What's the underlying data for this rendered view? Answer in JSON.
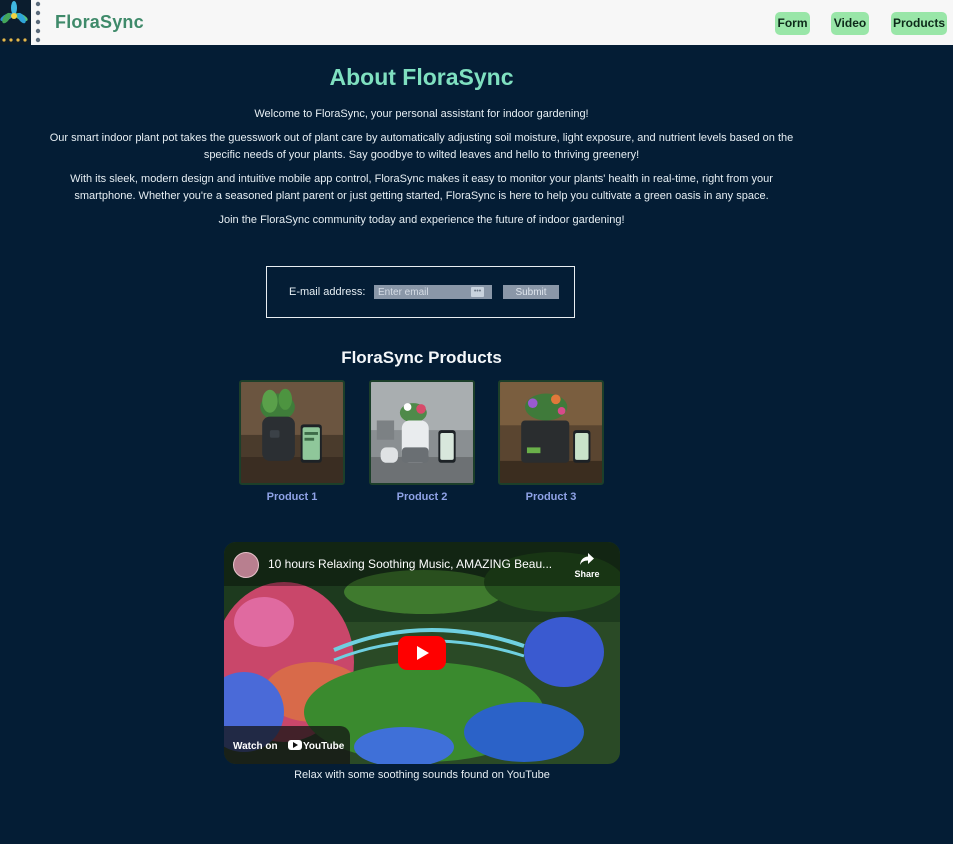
{
  "header": {
    "brand": "FloraSync",
    "nav": [
      {
        "label": "Form"
      },
      {
        "label": "Video"
      },
      {
        "label": "Products"
      }
    ]
  },
  "about": {
    "title": "About FloraSync",
    "paragraphs": [
      "Welcome to FloraSync, your personal assistant for indoor gardening!",
      "Our smart indoor plant pot takes the guesswork out of plant care by automatically adjusting soil moisture, light exposure, and nutrient levels based on the specific needs of your plants. Say goodbye to wilted leaves and hello to thriving greenery!",
      "With its sleek, modern design and intuitive mobile app control, FloraSync makes it easy to monitor your plants' health in real-time, right from your smartphone. Whether you're a seasoned plant parent or just getting started, FloraSync is here to help you cultivate a green oasis in any space.",
      "Join the FloraSync community today and experience the future of indoor gardening!"
    ]
  },
  "form": {
    "label": "E-mail address:",
    "placeholder": "Enter email",
    "value": "",
    "submit_label": "Submit"
  },
  "products": {
    "title": "FloraSync Products",
    "items": [
      {
        "label": "Product 1"
      },
      {
        "label": "Product 2"
      },
      {
        "label": "Product 3"
      }
    ]
  },
  "video": {
    "title": "10 hours Relaxing Soothing Music, AMAZING Beau...",
    "share_label": "Share",
    "watch_on_label": "Watch on",
    "platform_label": "YouTube",
    "caption": "Relax with some soothing sounds found on YouTube"
  },
  "colors": {
    "background": "#041d35",
    "accent": "#7fe0c0",
    "nav_button": "#99e6a8",
    "product_link": "#8fa2e6",
    "brand": "#3f8a6a"
  }
}
